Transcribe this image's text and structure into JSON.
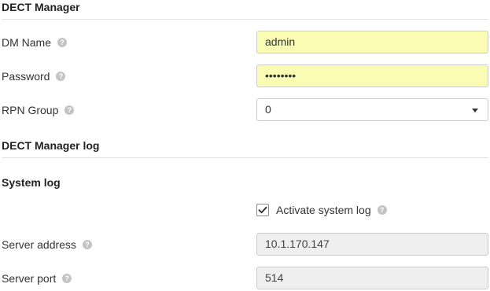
{
  "dect_manager": {
    "title": "DECT Manager",
    "dm_name": {
      "label": "DM Name",
      "value": "admin"
    },
    "password": {
      "label": "Password",
      "value": "••••••••"
    },
    "rpn_group": {
      "label": "RPN Group",
      "value": "0"
    }
  },
  "dect_manager_log": {
    "title": "DECT Manager log"
  },
  "system_log": {
    "title": "System log",
    "activate": {
      "label": "Activate system log",
      "checked": true
    },
    "server_address": {
      "label": "Server address",
      "value": "10.1.170.147"
    },
    "server_port": {
      "label": "Server port",
      "value": "514"
    }
  },
  "icons": {
    "help": "help-question-icon",
    "check": "checkmark-icon",
    "dropdown": "chevron-down-icon"
  },
  "colors": {
    "autofill_yellow": "#fafcb4",
    "disabled_grey": "#efefef",
    "border": "#cccccc"
  }
}
